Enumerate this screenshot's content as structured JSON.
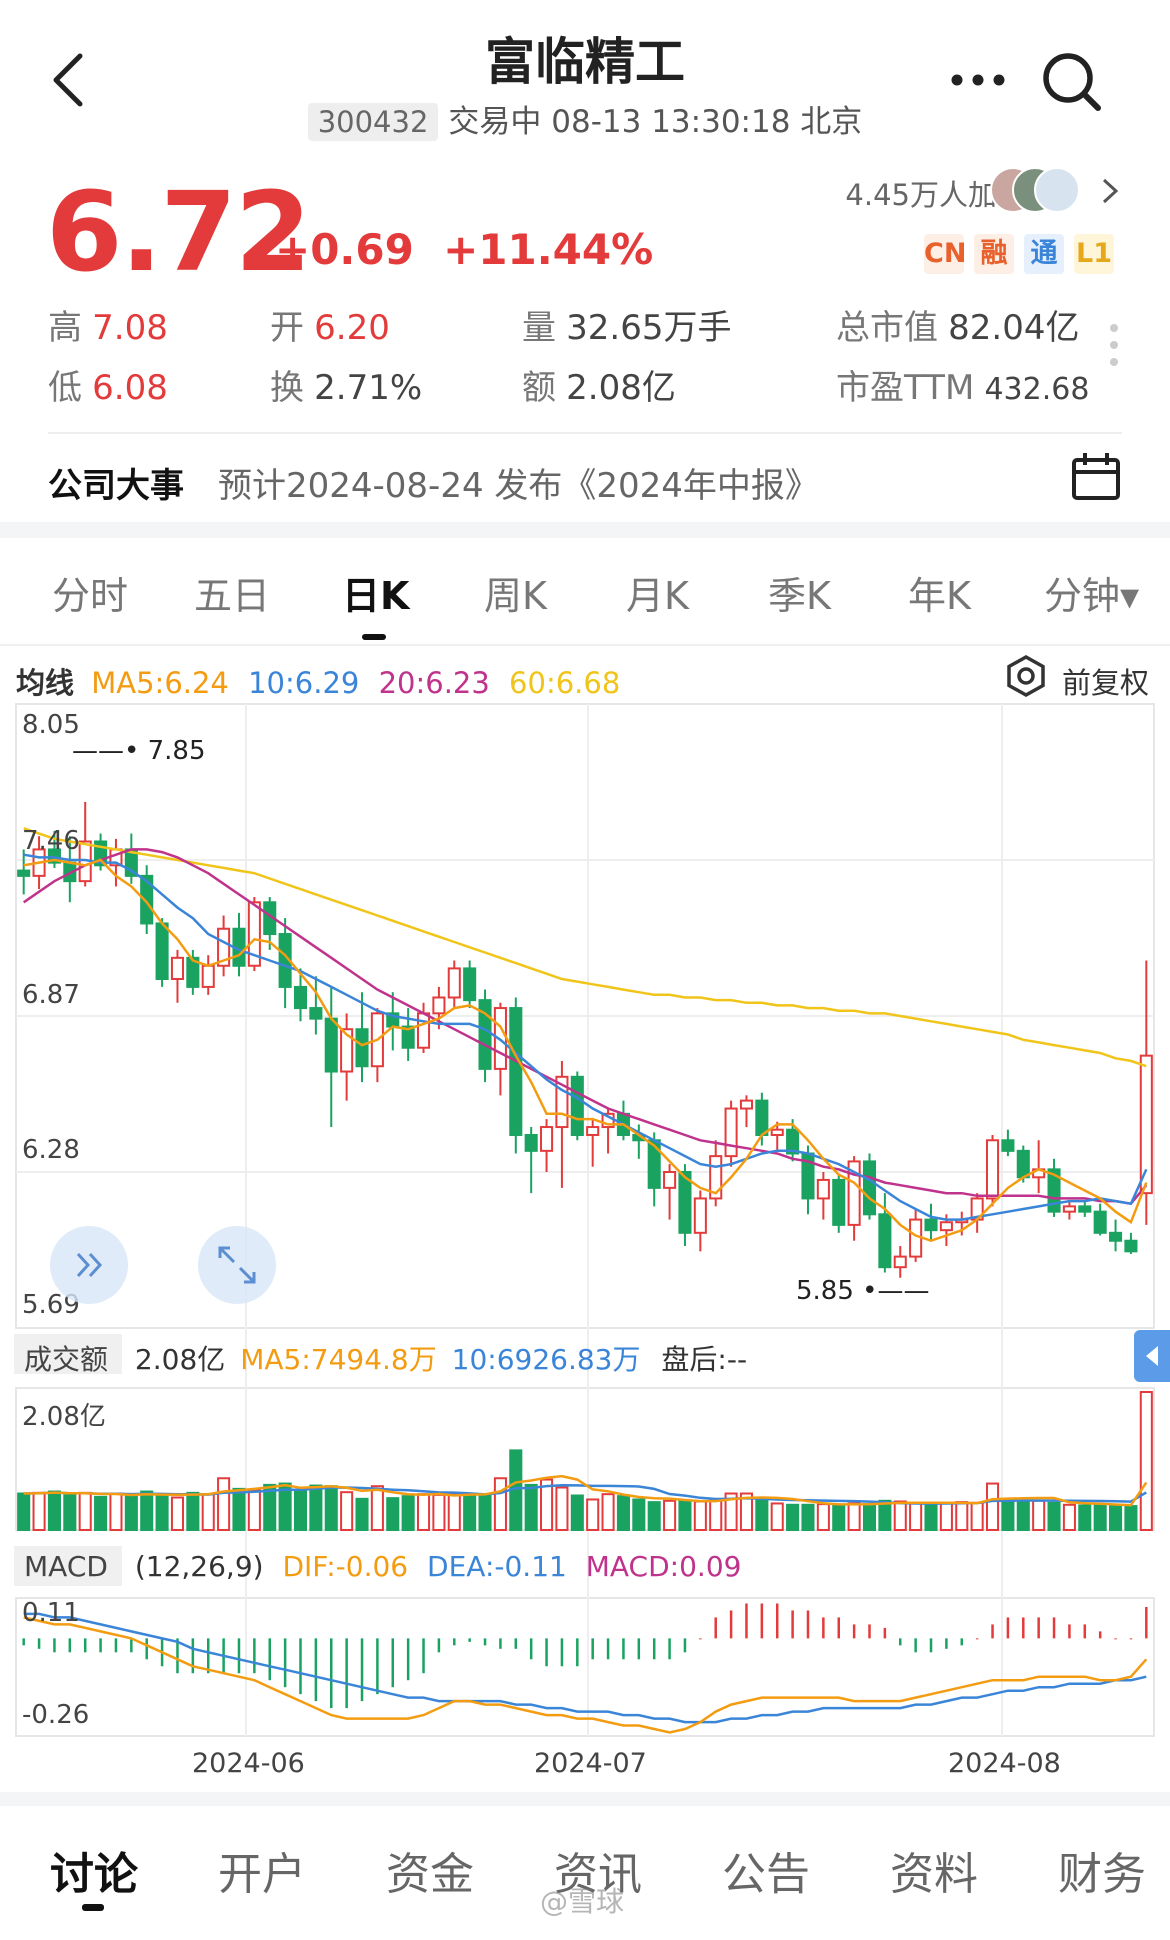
{
  "header": {
    "title": "富临精工",
    "code": "300432",
    "status": "交易中 08-13 13:30:18 北京"
  },
  "quote": {
    "price": "6.72",
    "change": "+0.69",
    "change_pct": "+11.44%",
    "followers": "4.45万人加自选",
    "badges": [
      "CN",
      "融",
      "通",
      "L1"
    ],
    "high_label": "高",
    "high": "7.08",
    "low_label": "低",
    "low": "6.08",
    "open_label": "开",
    "open": "6.20",
    "turnover_label": "换",
    "turnover": "2.71%",
    "volume_label": "量",
    "volume": "32.65万手",
    "amount_label": "额",
    "amount": "2.08亿",
    "mcap_label": "总市值",
    "mcap": "82.04亿",
    "pe_label": "市盈TTM",
    "pe": "432.68"
  },
  "event": {
    "label": "公司大事",
    "text": "预计2024-08-24 发布《2024年中报》"
  },
  "tabs": [
    "分时",
    "五日",
    "日K",
    "周K",
    "月K",
    "季K",
    "年K",
    "分钟▾"
  ],
  "ma_legend": {
    "label": "均线",
    "ma5": "MA5:6.24",
    "ma10": "10:6.29",
    "ma20": "20:6.23",
    "ma60": "60:6.68",
    "adjust": "前复权"
  },
  "kline": {
    "y_labels": [
      "8.05",
      "7.46",
      "6.87",
      "6.28",
      "5.69"
    ],
    "high_mark": "7.85",
    "low_mark": "5.85"
  },
  "volume_panel": {
    "label": "成交额",
    "value": "2.08亿",
    "ma5": "MA5:7494.8万",
    "ma10": "10:6926.83万",
    "after_hours": "盘后:--",
    "max_label": "2.08亿"
  },
  "macd_panel": {
    "label": "MACD",
    "params": "(12,26,9)",
    "dif": "DIF:-0.06",
    "dea": "DEA:-0.11",
    "macd": "MACD:0.09",
    "top_label": "0.11",
    "bottom_label": "-0.26"
  },
  "x_axis": [
    "2024-06",
    "2024-07",
    "2024-08"
  ],
  "bottom_tabs": [
    "讨论",
    "开户",
    "资金",
    "资讯",
    "公告",
    "资料",
    "财务"
  ],
  "watermark": "@雪球",
  "colors": {
    "up": "#e33b3b",
    "down": "#1aa260",
    "ma5": "#f39c12",
    "ma10": "#3a85d8",
    "ma20": "#c0338c",
    "ma60": "#f0c419"
  },
  "chart_data": {
    "type": "candlestick",
    "ohlc": [
      [
        7.42,
        7.5,
        7.33,
        7.4
      ],
      [
        7.4,
        7.55,
        7.35,
        7.5
      ],
      [
        7.5,
        7.57,
        7.43,
        7.45
      ],
      [
        7.45,
        7.55,
        7.3,
        7.38
      ],
      [
        7.38,
        7.68,
        7.36,
        7.53
      ],
      [
        7.53,
        7.56,
        7.42,
        7.44
      ],
      [
        7.44,
        7.54,
        7.36,
        7.5
      ],
      [
        7.5,
        7.56,
        7.37,
        7.4
      ],
      [
        7.4,
        7.44,
        7.18,
        7.22
      ],
      [
        7.22,
        7.24,
        6.98,
        7.01
      ],
      [
        7.01,
        7.12,
        6.92,
        7.09
      ],
      [
        7.09,
        7.12,
        6.95,
        6.98
      ],
      [
        6.98,
        7.1,
        6.95,
        7.06
      ],
      [
        7.06,
        7.25,
        7.02,
        7.2
      ],
      [
        7.2,
        7.26,
        7.02,
        7.06
      ],
      [
        7.06,
        7.32,
        7.04,
        7.3
      ],
      [
        7.3,
        7.32,
        7.12,
        7.18
      ],
      [
        7.18,
        7.24,
        6.9,
        6.98
      ],
      [
        6.98,
        7.05,
        6.85,
        6.9
      ],
      [
        6.9,
        7.02,
        6.8,
        6.86
      ],
      [
        6.86,
        6.98,
        6.45,
        6.66
      ],
      [
        6.66,
        6.88,
        6.55,
        6.82
      ],
      [
        6.82,
        6.96,
        6.62,
        6.68
      ],
      [
        6.68,
        6.9,
        6.62,
        6.88
      ],
      [
        6.88,
        6.96,
        6.74,
        6.83
      ],
      [
        6.83,
        6.9,
        6.7,
        6.75
      ],
      [
        6.75,
        6.92,
        6.73,
        6.88
      ],
      [
        6.88,
        6.98,
        6.82,
        6.94
      ],
      [
        6.94,
        7.08,
        6.9,
        7.05
      ],
      [
        7.05,
        7.08,
        6.9,
        6.93
      ],
      [
        6.93,
        6.97,
        6.62,
        6.67
      ],
      [
        6.67,
        6.92,
        6.57,
        6.9
      ],
      [
        6.9,
        6.94,
        6.35,
        6.42
      ],
      [
        6.42,
        6.45,
        6.2,
        6.36
      ],
      [
        6.36,
        6.48,
        6.28,
        6.45
      ],
      [
        6.45,
        6.7,
        6.22,
        6.64
      ],
      [
        6.64,
        6.66,
        6.4,
        6.42
      ],
      [
        6.42,
        6.48,
        6.3,
        6.45
      ],
      [
        6.45,
        6.52,
        6.35,
        6.5
      ],
      [
        6.5,
        6.55,
        6.4,
        6.42
      ],
      [
        6.42,
        6.46,
        6.33,
        6.4
      ],
      [
        6.4,
        6.43,
        6.15,
        6.22
      ],
      [
        6.22,
        6.31,
        6.1,
        6.28
      ],
      [
        6.28,
        6.31,
        6.0,
        6.05
      ],
      [
        6.05,
        6.21,
        5.98,
        6.18
      ],
      [
        6.18,
        6.4,
        6.15,
        6.34
      ],
      [
        6.34,
        6.55,
        6.3,
        6.52
      ],
      [
        6.52,
        6.57,
        6.45,
        6.55
      ],
      [
        6.55,
        6.58,
        6.38,
        6.42
      ],
      [
        6.42,
        6.47,
        6.36,
        6.44
      ],
      [
        6.44,
        6.48,
        6.32,
        6.35
      ],
      [
        6.35,
        6.38,
        6.12,
        6.18
      ],
      [
        6.18,
        6.28,
        6.1,
        6.25
      ],
      [
        6.25,
        6.27,
        6.05,
        6.08
      ],
      [
        6.08,
        6.34,
        6.02,
        6.32
      ],
      [
        6.32,
        6.35,
        6.1,
        6.12
      ],
      [
        6.12,
        6.2,
        5.9,
        5.92
      ],
      [
        5.92,
        6.0,
        5.88,
        5.96
      ],
      [
        5.96,
        6.14,
        5.94,
        6.1
      ],
      [
        6.1,
        6.16,
        6.02,
        6.06
      ],
      [
        6.06,
        6.12,
        6.0,
        6.09
      ],
      [
        6.09,
        6.13,
        6.04,
        6.1
      ],
      [
        6.1,
        6.2,
        6.05,
        6.18
      ],
      [
        6.18,
        6.42,
        6.15,
        6.4
      ],
      [
        6.4,
        6.44,
        6.34,
        6.36
      ],
      [
        6.36,
        6.38,
        6.24,
        6.26
      ],
      [
        6.26,
        6.4,
        6.2,
        6.29
      ],
      [
        6.29,
        6.33,
        6.11,
        6.13
      ],
      [
        6.13,
        6.17,
        6.1,
        6.15
      ],
      [
        6.15,
        6.17,
        6.11,
        6.13
      ],
      [
        6.13,
        6.16,
        6.04,
        6.05
      ],
      [
        6.05,
        6.1,
        5.98,
        6.02
      ],
      [
        6.02,
        6.05,
        5.97,
        5.98
      ],
      [
        6.2,
        7.08,
        6.08,
        6.72
      ]
    ],
    "ma5": [
      7.44,
      7.45,
      7.46,
      7.45,
      7.44,
      7.46,
      7.4,
      7.36,
      7.3,
      7.22,
      7.16,
      7.08,
      7.06,
      7.08,
      7.1,
      7.16,
      7.15,
      7.1,
      7.03,
      6.96,
      6.86,
      6.8,
      6.76,
      6.78,
      6.83,
      6.82,
      6.84,
      6.86,
      6.9,
      6.91,
      6.88,
      6.83,
      6.72,
      6.62,
      6.5,
      6.5,
      6.48,
      6.48,
      6.46,
      6.46,
      6.42,
      6.38,
      6.32,
      6.26,
      6.22,
      6.2,
      6.26,
      6.33,
      6.42,
      6.46,
      6.46,
      6.4,
      6.33,
      6.27,
      6.24,
      6.18,
      6.14,
      6.08,
      6.04,
      6.02,
      6.04,
      6.06,
      6.1,
      6.16,
      6.22,
      6.26,
      6.29,
      6.27,
      6.24,
      6.21,
      6.18,
      6.13,
      6.09,
      6.24
    ],
    "ma10": [
      7.48,
      7.47,
      7.47,
      7.46,
      7.46,
      7.45,
      7.45,
      7.42,
      7.38,
      7.33,
      7.28,
      7.24,
      7.18,
      7.15,
      7.12,
      7.1,
      7.08,
      7.06,
      7.04,
      7.01,
      6.98,
      6.95,
      6.92,
      6.89,
      6.87,
      6.86,
      6.85,
      6.84,
      6.84,
      6.84,
      6.82,
      6.78,
      6.73,
      6.68,
      6.63,
      6.59,
      6.56,
      6.52,
      6.49,
      6.46,
      6.43,
      6.4,
      6.37,
      6.34,
      6.31,
      6.3,
      6.31,
      6.33,
      6.35,
      6.36,
      6.36,
      6.35,
      6.33,
      6.31,
      6.28,
      6.25,
      6.21,
      6.17,
      6.14,
      6.11,
      6.1,
      6.1,
      6.11,
      6.12,
      6.13,
      6.14,
      6.15,
      6.16,
      6.17,
      6.17,
      6.18,
      6.17,
      6.16,
      6.29
    ],
    "ma20": [
      7.3,
      7.34,
      7.38,
      7.41,
      7.44,
      7.46,
      7.48,
      7.5,
      7.5,
      7.49,
      7.47,
      7.44,
      7.41,
      7.37,
      7.33,
      7.29,
      7.25,
      7.21,
      7.17,
      7.13,
      7.09,
      7.05,
      7.01,
      6.97,
      6.94,
      6.91,
      6.88,
      6.85,
      6.82,
      6.79,
      6.76,
      6.73,
      6.7,
      6.67,
      6.64,
      6.61,
      6.58,
      6.55,
      6.52,
      6.5,
      6.48,
      6.46,
      6.44,
      6.42,
      6.4,
      6.39,
      6.38,
      6.37,
      6.36,
      6.35,
      6.33,
      6.32,
      6.3,
      6.29,
      6.27,
      6.26,
      6.24,
      6.23,
      6.22,
      6.21,
      6.2,
      6.2,
      6.19,
      6.19,
      6.19,
      6.19,
      6.19,
      6.18,
      6.18,
      6.18,
      6.17,
      6.17,
      6.16,
      6.23
    ],
    "ma60": [
      7.58,
      7.56,
      7.54,
      7.53,
      7.52,
      7.51,
      7.5,
      7.49,
      7.48,
      7.47,
      7.46,
      7.45,
      7.44,
      7.43,
      7.42,
      7.41,
      7.39,
      7.37,
      7.35,
      7.33,
      7.31,
      7.29,
      7.27,
      7.25,
      7.23,
      7.21,
      7.19,
      7.17,
      7.15,
      7.13,
      7.11,
      7.09,
      7.07,
      7.05,
      7.03,
      7.01,
      7.0,
      6.99,
      6.98,
      6.97,
      6.96,
      6.95,
      6.95,
      6.94,
      6.94,
      6.93,
      6.93,
      6.92,
      6.92,
      6.91,
      6.91,
      6.9,
      6.9,
      6.89,
      6.89,
      6.88,
      6.88,
      6.87,
      6.86,
      6.85,
      6.84,
      6.83,
      6.82,
      6.81,
      6.8,
      6.78,
      6.77,
      6.76,
      6.75,
      6.74,
      6.73,
      6.71,
      6.7,
      6.68
    ],
    "amount_yi": [
      0.55,
      0.56,
      0.58,
      0.52,
      0.56,
      0.5,
      0.55,
      0.51,
      0.58,
      0.53,
      0.49,
      0.56,
      0.54,
      0.78,
      0.62,
      0.6,
      0.68,
      0.7,
      0.58,
      0.67,
      0.66,
      0.57,
      0.47,
      0.66,
      0.48,
      0.51,
      0.54,
      0.53,
      0.54,
      0.55,
      0.52,
      0.78,
      1.2,
      0.68,
      0.76,
      0.64,
      0.52,
      0.46,
      0.54,
      0.51,
      0.46,
      0.42,
      0.44,
      0.43,
      0.43,
      0.46,
      0.55,
      0.55,
      0.46,
      0.4,
      0.38,
      0.38,
      0.39,
      0.38,
      0.4,
      0.39,
      0.44,
      0.43,
      0.4,
      0.39,
      0.4,
      0.42,
      0.41,
      0.7,
      0.44,
      0.42,
      0.44,
      0.41,
      0.38,
      0.37,
      0.38,
      0.38,
      0.36,
      2.08
    ],
    "dif": [
      0.06,
      0.05,
      0.04,
      0.04,
      0.03,
      0.02,
      0.01,
      0.0,
      -0.02,
      -0.04,
      -0.06,
      -0.08,
      -0.09,
      -0.1,
      -0.11,
      -0.12,
      -0.14,
      -0.16,
      -0.18,
      -0.2,
      -0.22,
      -0.23,
      -0.23,
      -0.23,
      -0.23,
      -0.23,
      -0.22,
      -0.2,
      -0.18,
      -0.18,
      -0.19,
      -0.19,
      -0.2,
      -0.21,
      -0.22,
      -0.22,
      -0.23,
      -0.23,
      -0.24,
      -0.25,
      -0.25,
      -0.26,
      -0.27,
      -0.26,
      -0.24,
      -0.21,
      -0.19,
      -0.18,
      -0.17,
      -0.17,
      -0.17,
      -0.17,
      -0.17,
      -0.17,
      -0.18,
      -0.18,
      -0.18,
      -0.18,
      -0.17,
      -0.16,
      -0.15,
      -0.14,
      -0.13,
      -0.12,
      -0.12,
      -0.12,
      -0.11,
      -0.11,
      -0.11,
      -0.11,
      -0.12,
      -0.12,
      -0.11,
      -0.06
    ],
    "dea": [
      0.07,
      0.07,
      0.06,
      0.06,
      0.05,
      0.04,
      0.03,
      0.02,
      0.01,
      0.0,
      -0.01,
      -0.03,
      -0.04,
      -0.05,
      -0.06,
      -0.07,
      -0.08,
      -0.09,
      -0.1,
      -0.11,
      -0.12,
      -0.13,
      -0.14,
      -0.15,
      -0.16,
      -0.17,
      -0.17,
      -0.18,
      -0.18,
      -0.18,
      -0.18,
      -0.18,
      -0.19,
      -0.19,
      -0.2,
      -0.2,
      -0.21,
      -0.21,
      -0.21,
      -0.22,
      -0.22,
      -0.23,
      -0.23,
      -0.24,
      -0.24,
      -0.24,
      -0.23,
      -0.23,
      -0.22,
      -0.22,
      -0.21,
      -0.21,
      -0.2,
      -0.2,
      -0.2,
      -0.2,
      -0.2,
      -0.2,
      -0.19,
      -0.19,
      -0.18,
      -0.17,
      -0.17,
      -0.16,
      -0.15,
      -0.15,
      -0.14,
      -0.14,
      -0.13,
      -0.13,
      -0.13,
      -0.12,
      -0.12,
      -0.11
    ],
    "macd": [
      -0.02,
      -0.03,
      -0.04,
      -0.04,
      -0.04,
      -0.04,
      -0.04,
      -0.04,
      -0.06,
      -0.08,
      -0.1,
      -0.1,
      -0.1,
      -0.1,
      -0.1,
      -0.1,
      -0.12,
      -0.14,
      -0.16,
      -0.18,
      -0.2,
      -0.2,
      -0.18,
      -0.16,
      -0.14,
      -0.12,
      -0.1,
      -0.04,
      -0.02,
      -0.01,
      -0.02,
      -0.03,
      -0.03,
      -0.06,
      -0.08,
      -0.08,
      -0.08,
      -0.06,
      -0.06,
      -0.06,
      -0.06,
      -0.06,
      -0.06,
      -0.04,
      0.0,
      0.06,
      0.08,
      0.1,
      0.1,
      0.1,
      0.08,
      0.08,
      0.06,
      0.06,
      0.04,
      0.04,
      0.03,
      -0.02,
      -0.04,
      -0.04,
      -0.03,
      -0.02,
      0.0,
      0.04,
      0.06,
      0.06,
      0.06,
      0.06,
      0.04,
      0.04,
      0.02,
      0.0,
      0.0,
      0.09
    ]
  }
}
